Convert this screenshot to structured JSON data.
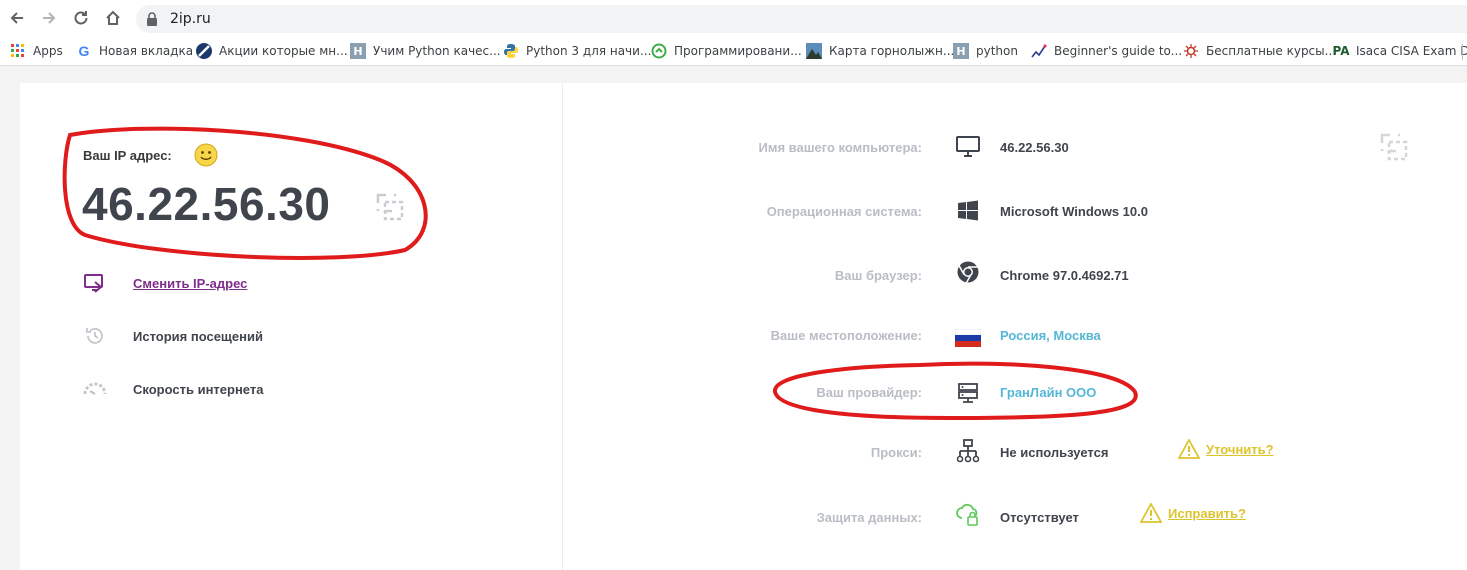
{
  "browser": {
    "url": "2ip.ru",
    "bookmarks": [
      {
        "label": "Apps",
        "icon": "apps-grid-icon"
      },
      {
        "label": "Новая вкладка",
        "icon": "google-icon"
      },
      {
        "label": "Акции которые мн...",
        "icon": "stripe-icon"
      },
      {
        "label": "Учим Python качес...",
        "icon": "habr-icon"
      },
      {
        "label": "Python 3 для начи...",
        "icon": "python-icon"
      },
      {
        "label": "Программировани...",
        "icon": "green-circle-icon"
      },
      {
        "label": "Карта горнолыжн...",
        "icon": "mountain-icon"
      },
      {
        "label": "python",
        "icon": "habr-icon"
      },
      {
        "label": "Beginner's guide to...",
        "icon": "chart-icon"
      },
      {
        "label": "Бесплатные курсы...",
        "icon": "virus-icon"
      },
      {
        "label": "Isaca CISA Exam Du...",
        "icon": "pa-icon"
      }
    ]
  },
  "left": {
    "ip_label": "Ваш IP адрес:",
    "ip_value": "46.22.56.30",
    "links": [
      {
        "label": "Сменить IP-адрес",
        "icon": "change-ip-icon"
      },
      {
        "label": "История посещений",
        "icon": "history-icon"
      },
      {
        "label": "Скорость интернета",
        "icon": "speedometer-icon"
      }
    ]
  },
  "right": {
    "computer_name": {
      "label": "Имя вашего компьютера:",
      "value": "46.22.56.30"
    },
    "os": {
      "label": "Операционная система:",
      "value": "Microsoft Windows 10.0"
    },
    "browser": {
      "label": "Ваш браузер:",
      "value": "Chrome 97.0.4692.71"
    },
    "location": {
      "label": "Ваше местоположение:",
      "value": "Россия, Москва"
    },
    "provider": {
      "label": "Ваш провайдер:",
      "value": "ГранЛайн ООО"
    },
    "proxy": {
      "label": "Прокси:",
      "value": "Не используется",
      "action": "Уточнить?"
    },
    "protection": {
      "label": "Защита данных:",
      "value": "Отсутствует",
      "action": "Исправить?"
    }
  },
  "colors": {
    "accent_link": "#55b7d7",
    "purple_link": "#7e2d8c",
    "warning": "#dcc42d",
    "annotation": "#e01b1b"
  }
}
